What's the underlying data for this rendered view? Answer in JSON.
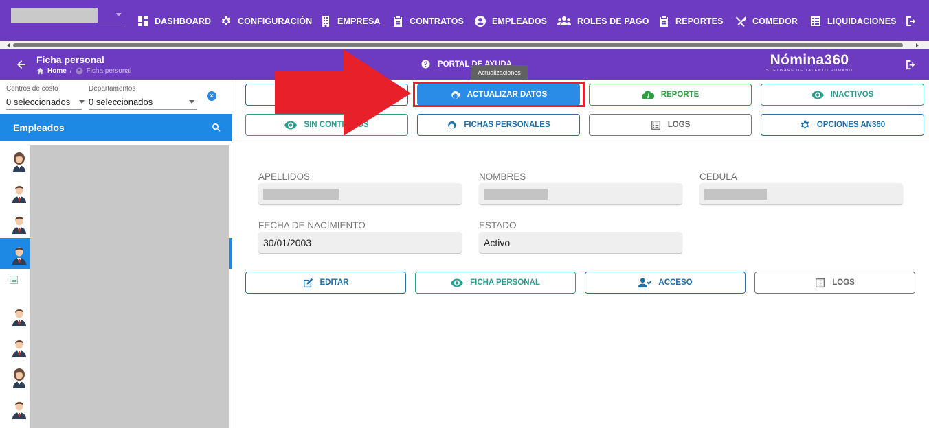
{
  "topnav": {
    "company_select": {
      "value": "",
      "blurred": true
    },
    "items": [
      {
        "label": "DASHBOARD",
        "icon": "dashboard-icon"
      },
      {
        "label": "CONFIGURACIÓN",
        "icon": "gear-icon"
      },
      {
        "label": "EMPRESA",
        "icon": "building-icon"
      },
      {
        "label": "CONTRATOS",
        "icon": "clipboard-icon"
      },
      {
        "label": "EMPLEADOS",
        "icon": "user-circle-icon"
      },
      {
        "label": "ROLES DE PAGO",
        "icon": "users-icon"
      },
      {
        "label": "REPORTES",
        "icon": "clipboard-icon"
      },
      {
        "label": "COMEDOR",
        "icon": "utensils-icon"
      },
      {
        "label": "LIQUIDACIONES",
        "icon": "list-icon"
      }
    ],
    "logout_icon": "logout-icon"
  },
  "subheader": {
    "title": "Ficha personal",
    "breadcrumb": {
      "home": "Home",
      "separator": "/",
      "current": "Ficha personal"
    },
    "help_label": "PORTAL DE AYUDA",
    "brand": {
      "name": "Nómina360",
      "tagline": "SOFTWARE DE TALENTO HUMANO"
    }
  },
  "tooltip": "Actualizaciones",
  "filters": {
    "cost_centers": {
      "label": "Centros de costo",
      "value": "0 seleccionados"
    },
    "departments": {
      "label": "Departamentos",
      "value": "0 seleccionados"
    },
    "clear_label": "×"
  },
  "employees": {
    "title": "Empleados",
    "rows": [
      {
        "gender": "female",
        "active": false
      },
      {
        "gender": "male",
        "active": false
      },
      {
        "gender": "male",
        "active": false
      },
      {
        "gender": "male",
        "active": true
      },
      {
        "gender": "broken",
        "active": false
      },
      {
        "gender": "male",
        "active": false
      },
      {
        "gender": "male",
        "active": false
      },
      {
        "gender": "female",
        "active": false
      },
      {
        "gender": "male",
        "active": false
      }
    ]
  },
  "actions": {
    "row1": [
      {
        "label": "",
        "style": "blue",
        "icon": ""
      },
      {
        "label": "ACTUALIZAR DATOS",
        "style": "solid",
        "icon": "refresh-icon"
      },
      {
        "label": "REPORTE",
        "style": "green",
        "icon": "cloud-download-icon"
      },
      {
        "label": "INACTIVOS",
        "style": "teal",
        "icon": "eye-icon"
      }
    ],
    "row2": [
      {
        "label": "SIN CONTRATOS",
        "style": "teal",
        "icon": "eye-icon"
      },
      {
        "label": "FICHAS PERSONALES",
        "style": "blue",
        "icon": "refresh-icon"
      },
      {
        "label": "LOGS",
        "style": "gray",
        "icon": "list-icon"
      },
      {
        "label": "OPCIONES AN360",
        "style": "blue",
        "icon": "gear-icon"
      }
    ]
  },
  "details": {
    "apellidos": {
      "label": "APELLIDOS",
      "value": ""
    },
    "nombres": {
      "label": "NOMBRES",
      "value": ""
    },
    "cedula": {
      "label": "CEDULA",
      "value": ""
    },
    "fecha_nacimiento": {
      "label": "FECHA DE NACIMIENTO",
      "value": "30/01/2003"
    },
    "estado": {
      "label": "ESTADO",
      "value": "Activo"
    }
  },
  "detail_actions": [
    {
      "label": "EDITAR",
      "style": "blue",
      "icon": "edit-icon"
    },
    {
      "label": "FICHA PERSONAL",
      "style": "teal",
      "icon": "eye-icon"
    },
    {
      "label": "ACCESO",
      "style": "blue",
      "icon": "user-check-icon"
    },
    {
      "label": "LOGS",
      "style": "gray",
      "icon": "list-icon"
    }
  ],
  "colors": {
    "nav_purple": "#6d3bbf",
    "primary_blue": "#1e88e5",
    "annotation_red": "#e8202a"
  }
}
